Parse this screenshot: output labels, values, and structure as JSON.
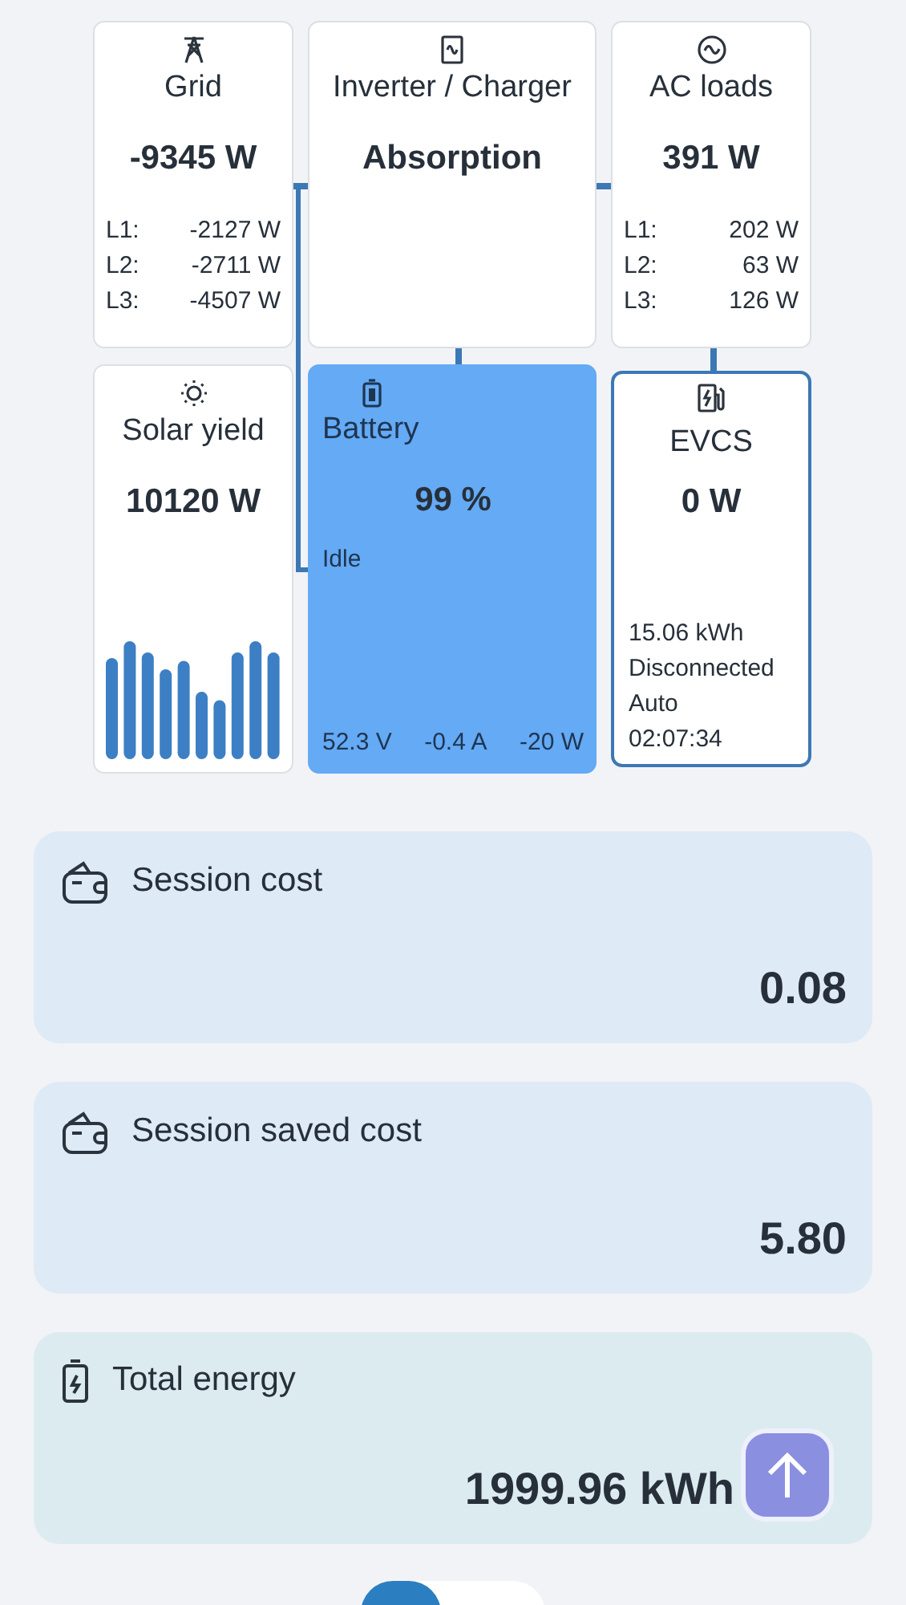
{
  "top_cards": [
    {
      "kind": "grid",
      "title": "Grid",
      "value": "-9345 W",
      "phases": [
        {
          "label": "L1:",
          "value": "-2127 W"
        },
        {
          "label": "L2:",
          "value": "-2711 W"
        },
        {
          "label": "L3:",
          "value": "-4507 W"
        }
      ]
    },
    {
      "kind": "inverter",
      "title": "Inverter / Charger",
      "value": "Absorption"
    },
    {
      "kind": "ac",
      "title": "AC loads",
      "value": "391 W",
      "phases": [
        {
          "label": "L1:",
          "value": "202 W"
        },
        {
          "label": "L2:",
          "value": "63 W"
        },
        {
          "label": "L3:",
          "value": "126 W"
        }
      ]
    }
  ],
  "solar": {
    "title": "Solar yield",
    "value": "10120 W"
  },
  "battery": {
    "title": "Battery",
    "value": "99 %",
    "state": "Idle",
    "readings": [
      "52.3 V",
      "-0.4 A",
      "-20 W"
    ]
  },
  "evcs": {
    "title": "EVCS",
    "value": "0 W",
    "details": [
      "15.06 kWh",
      "Disconnected",
      "Auto",
      "02:07:34"
    ]
  },
  "metrics": [
    {
      "kind": "wallet",
      "label": "Session cost",
      "value": "0.08"
    },
    {
      "kind": "wallet",
      "label": "Session saved cost",
      "value": "5.80"
    },
    {
      "kind": "energy",
      "label": "Total energy",
      "value": "1999.96 kWh"
    }
  ],
  "view_switch": {
    "on": false
  }
}
